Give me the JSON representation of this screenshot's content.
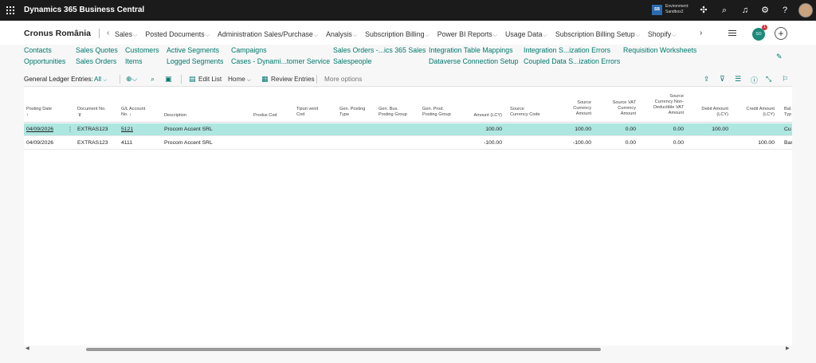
{
  "app": {
    "title": "Dynamics 365 Business Central"
  },
  "environment": {
    "badge": "SB",
    "label": "Environment:",
    "name": "Sandbox2"
  },
  "header": {
    "company": "Cronus România",
    "nav": [
      "Sales",
      "Posted Documents",
      "Administration Sales/Purchase",
      "Analysis",
      "Subscription Billing",
      "Power BI Reports",
      "Usage Data",
      "Subscription Billing Setup",
      "Shopify"
    ],
    "copilot_label": "SO",
    "copilot_count": "1"
  },
  "quicklinks": {
    "row1": [
      "Contacts",
      "Sales Quotes",
      "Customers",
      "Active Segments",
      "Campaigns",
      "Sales Orders -...ics 365 Sales",
      "Integration Table Mappings",
      "Integration S...ization Errors",
      "Requisition Worksheets"
    ],
    "row2": [
      "Opportunities",
      "Sales Orders",
      "Items",
      "Logged Segments",
      "Cases - Dynami...tomer Service",
      "Salespeople",
      "Dataverse Connection Setup",
      "Coupled Data S...ization Errors"
    ]
  },
  "actionbar": {
    "title": "General Ledger Entries:",
    "filter": "All",
    "edit_list": "Edit List",
    "home": "Home",
    "review_entries": "Review Entries",
    "more_options": "More options"
  },
  "table": {
    "headers": [
      "Posting Date\n↓",
      "Document No.",
      "G/L Account\nNo. ↓",
      "Description",
      "Produs Cod",
      "Tipuri venit\nCod",
      "Gen. Posting\nType",
      "Gen. Bus.\nPosting Group",
      "Gen. Prod.\nPosting Group",
      "Amount (LCY)",
      "Source\nCurrency Code",
      "Source\nCurrency\nAmount",
      "Source VAT\nCurrency\nAmount",
      "Source\nCurrency Non-\nDeductible VAT\nAmount",
      "Debit Amount\n(LCY)",
      "Credit Amount\n(LCY)",
      "Bal.\nTyp"
    ],
    "rows": [
      {
        "posting_date": "04/09/2026",
        "document_no": "EXTRAS123",
        "gl_account": "5121",
        "description": "Procom Accent SRL",
        "amount": "100.00",
        "src_amount": "100.00",
        "src_vat": "0.00",
        "src_nd_vat": "0.00",
        "debit": "100.00",
        "credit": "",
        "bal_type": "Cu"
      },
      {
        "posting_date": "04/09/2026",
        "document_no": "EXTRAS123",
        "gl_account": "4111",
        "description": "Procom Accent SRL",
        "amount": "-100.00",
        "src_amount": "-100.00",
        "src_vat": "0.00",
        "src_nd_vat": "0.00",
        "debit": "",
        "credit": "100.00",
        "bal_type": "Bar"
      }
    ]
  },
  "colors": {
    "accent": "#00786b",
    "selected_row": "#aee6e0",
    "topbar": "#1b1b1b"
  }
}
